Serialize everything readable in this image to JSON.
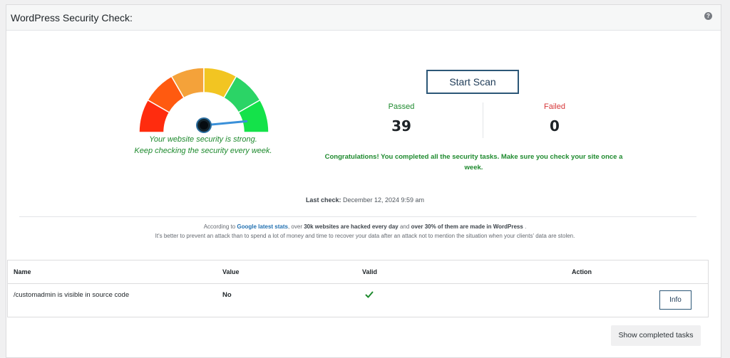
{
  "header": {
    "title": "WordPress Security Check:",
    "help_icon": "?"
  },
  "gauge": {
    "level": 0.97,
    "segment_colors": [
      "#ff2c0e",
      "#ff5a10",
      "#f4a23a",
      "#f2c522",
      "#2bd466",
      "#14e24a"
    ],
    "needle_color": "#3a90d9",
    "message_line1": "Your website security is strong.",
    "message_line2": "Keep checking the security every week."
  },
  "scan": {
    "start_label": "Start Scan",
    "passed_label": "Passed",
    "passed_count": "39",
    "failed_label": "Failed",
    "failed_count": "0",
    "congrats": "Congratulations! You completed all the security tasks. Make sure you check your site once a week."
  },
  "last_check": {
    "label": "Last check:",
    "value": "December 12, 2024 9:59 am"
  },
  "info": {
    "part1": "According to",
    "link": "Google latest stats",
    "part2": ", over",
    "bold1": "30k websites are hacked every day",
    "part3": "and",
    "bold2": "over 30% of them are made in WordPress",
    "part4": ".",
    "line2": "It's better to prevent an attack than to spend a lot of money and time to recover your data after an attack not to mention the situation when your clients' data are stolen."
  },
  "table": {
    "headers": [
      "Name",
      "Value",
      "Valid",
      "Action"
    ],
    "rows": [
      {
        "name": "/customadmin is visible in source code",
        "value": "No",
        "valid": "✔",
        "action": "Info"
      }
    ]
  },
  "footer": {
    "show_completed_label": "Show completed tasks"
  },
  "colors": {
    "success": "#1e8a2e",
    "danger": "#d63638",
    "button_border": "#2c5777",
    "link": "#2271b1"
  }
}
